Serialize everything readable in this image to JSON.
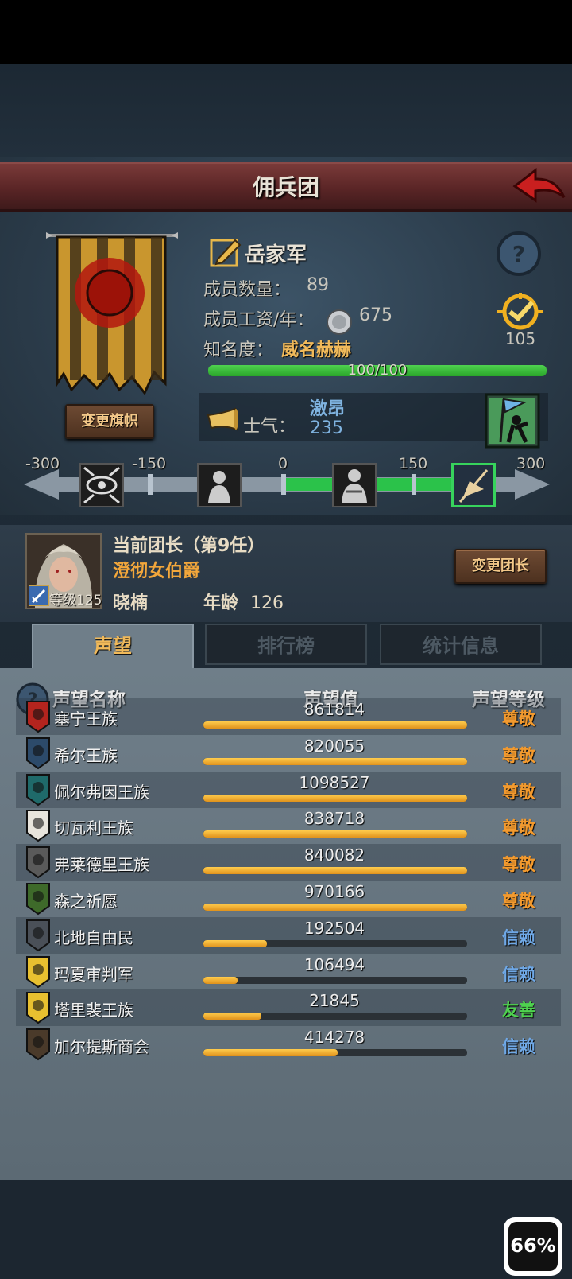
{
  "header": {
    "title": "佣兵团"
  },
  "legion": {
    "name": "岳家军",
    "members_label": "成员数量：",
    "members": "89",
    "salary_label": "成员工资/年：",
    "salary": "675",
    "fame_label": "知名度：",
    "fame_title": "威名赫赫",
    "fame_text": "100/100",
    "fame_progress": 1.0,
    "rank": "105",
    "change_flag_label": "变更旗帜"
  },
  "morale": {
    "label": "士气：",
    "state": "激昂",
    "value": "235",
    "scale_labels": [
      "-300",
      "-150",
      "0",
      "150",
      "300"
    ]
  },
  "leader": {
    "title": "当前团长（第9任）",
    "name": "澄彻女伯爵",
    "given_name": "晓楠",
    "age_label": "年龄",
    "age": "126",
    "level_text": "等级125",
    "change_leader_label": "变更团长"
  },
  "tabs": [
    {
      "label": "声望",
      "active": true
    },
    {
      "label": "排行榜",
      "active": false
    },
    {
      "label": "统计信息",
      "active": false
    }
  ],
  "table": {
    "headers": [
      "声望名称",
      "声望值",
      "声望等级"
    ],
    "rows": [
      {
        "name": "塞宁王族",
        "value": "861814",
        "progress": 1.0,
        "level": "尊敬",
        "level_color": "#f39a2e",
        "icon": "red-crest-icon"
      },
      {
        "name": "希尔王族",
        "value": "820055",
        "progress": 1.0,
        "level": "尊敬",
        "level_color": "#f39a2e",
        "icon": "blue-tower-icon"
      },
      {
        "name": "佩尔弗因王族",
        "value": "1098527",
        "progress": 1.0,
        "level": "尊敬",
        "level_color": "#f39a2e",
        "icon": "teal-moon-icon"
      },
      {
        "name": "切瓦利王族",
        "value": "838718",
        "progress": 1.0,
        "level": "尊敬",
        "level_color": "#f39a2e",
        "icon": "scales-icon"
      },
      {
        "name": "弗莱德里王族",
        "value": "840082",
        "progress": 1.0,
        "level": "尊敬",
        "level_color": "#f39a2e",
        "icon": "grey-wolf-icon"
      },
      {
        "name": "森之祈愿",
        "value": "970166",
        "progress": 1.0,
        "level": "尊敬",
        "level_color": "#f39a2e",
        "icon": "tree-icon"
      },
      {
        "name": "北地自由民",
        "value": "192504",
        "progress": 0.24,
        "level": "信赖",
        "level_color": "#6fa8e6",
        "icon": "axe-icon"
      },
      {
        "name": "玛夏审判军",
        "value": "106494",
        "progress": 0.13,
        "level": "信赖",
        "level_color": "#6fa8e6",
        "icon": "sun-cross-icon"
      },
      {
        "name": "塔里裴王族",
        "value": "21845",
        "progress": 0.22,
        "level": "友善",
        "level_color": "#4fd24f",
        "icon": "crown-fire-icon"
      },
      {
        "name": "加尔提斯商会",
        "value": "414278",
        "progress": 0.51,
        "level": "信赖",
        "level_color": "#6fa8e6",
        "icon": "chest-icon"
      }
    ]
  },
  "status": {
    "battery": "66%"
  },
  "colors": {
    "morale_blue": "#7fb3e0",
    "respect_orange": "#f39a2e",
    "trust_blue": "#6fa8e6",
    "friendly_green": "#4fd24f",
    "leader_gold": "#f3a73b"
  }
}
